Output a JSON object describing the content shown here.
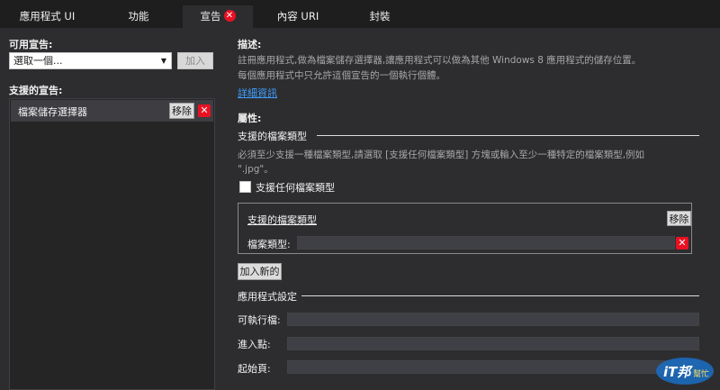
{
  "tabs": [
    {
      "label": "應用程式 UI",
      "active": false
    },
    {
      "label": "功能",
      "active": false
    },
    {
      "label": "宣告",
      "active": true,
      "has_error": true
    },
    {
      "label": "內容 URI",
      "active": false
    },
    {
      "label": "封裝",
      "active": false
    }
  ],
  "left": {
    "available_label": "可用宣告:",
    "available_select_value": "選取一個...",
    "add_button": "加入",
    "supported_label": "支援的宣告:",
    "supported_items": [
      {
        "label": "檔案儲存選擇器",
        "remove": "移除"
      }
    ]
  },
  "right": {
    "description_title": "描述:",
    "description_line1": "註冊應用程式,做為檔案儲存選擇器,讓應用程式可以做為其他 Windows 8 應用程式的儲存位置。",
    "description_line2": "每個應用程式中只允許這個宣告的一個執行個體。",
    "more_info_link": "詳細資訊",
    "properties_title": "屬性:",
    "file_types_section": "支援的檔案類型",
    "file_types_hint_line1": "必須至少支援一種檔案類型,請選取 [支援任何檔案類型] 方塊或輸入至少一種特定的檔案類型,例如",
    "file_types_hint_line2": "\".jpg\"。",
    "any_file_type_checkbox": "支援任何檔案類型",
    "box_title": "支援的檔案類型",
    "box_remove": "移除",
    "file_type_label": "檔案類型:",
    "add_new_button": "加入新的",
    "app_settings_section": "應用程式設定",
    "executable_label": "可執行檔:",
    "entry_point_label": "進入點:",
    "start_page_label": "起始頁:"
  },
  "logo": {
    "text": "iT邦",
    "sub": "幫忙"
  },
  "colors": {
    "error": "#e81123",
    "link": "#3f9fff",
    "background": "#2d2d30"
  }
}
